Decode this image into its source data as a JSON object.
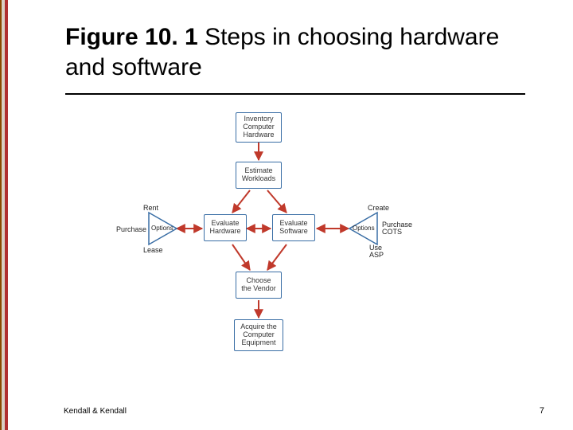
{
  "title": {
    "figure": "Figure 10. 1",
    "rest": " Steps in choosing hardware and software"
  },
  "footer": "Kendall & Kendall",
  "page_number": "7",
  "diagram": {
    "boxes": {
      "inventory": "Inventory\nComputer\nHardware",
      "estimate": "Estimate\nWorkloads",
      "eval_hw": "Evaluate\nHardware",
      "eval_sw": "Evaluate\nSoftware",
      "vendor": "Choose\nthe Vendor",
      "acquire": "Acquire the\nComputer\nEquipment"
    },
    "left_options": {
      "title": "Options",
      "labels": {
        "rent": "Rent",
        "purchase": "Purchase",
        "lease": "Lease"
      }
    },
    "right_options": {
      "title": "Options",
      "labels": {
        "create": "Create",
        "cots": "Purchase\nCOTS",
        "asp": "Use\nASP"
      }
    }
  }
}
